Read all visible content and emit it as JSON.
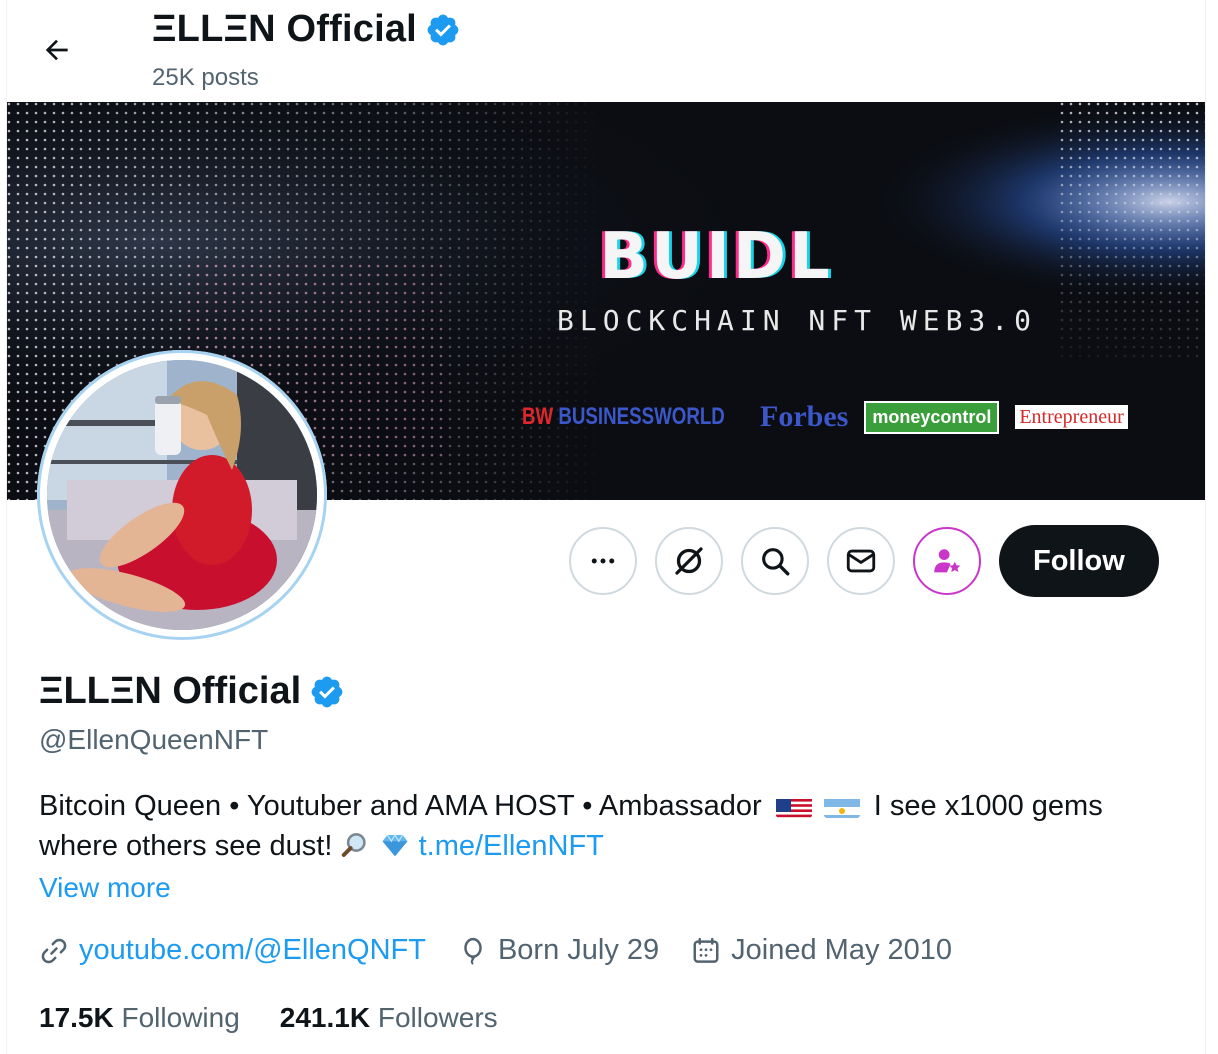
{
  "header": {
    "name": "ΞLLΞN Official",
    "posts": "25K posts"
  },
  "banner": {
    "title": "BUIDL",
    "tagline": "BLOCKCHAIN NFT WEB3.0",
    "logos": {
      "bw_prefix": "BW",
      "bw_name": "BUSINESSWORLD",
      "forbes": "Forbes",
      "moneycontrol": "moneycontrol",
      "entrepreneur": "Entrepreneur"
    }
  },
  "actions": {
    "more_icon": "more-icon",
    "grok_icon": "grok-icon",
    "search_icon": "search-icon",
    "message_icon": "envelope-icon",
    "subscribe_icon": "subscribe-person-star-icon",
    "follow_label": "Follow"
  },
  "profile": {
    "name": "ΞLLΞN Official",
    "handle": "@EllenQueenNFT",
    "bio_part1": "Bitcoin Queen • Youtuber and AMA HOST • Ambassador",
    "bio_part2": "I see x1000 gems where others see dust!",
    "bio_link": "t.me/EllenNFT",
    "view_more": "View more",
    "website": "youtube.com/@EllenQNFT",
    "birthday": "Born July 29",
    "joined": "Joined May 2010",
    "following_count": "17.5K",
    "following_label": "Following",
    "followers_count": "241.1K",
    "followers_label": "Followers"
  },
  "colors": {
    "accent": "#1d9bf0",
    "verified": "#1d9bf0",
    "subscribe": "#c936c9",
    "text_secondary": "#536471"
  }
}
